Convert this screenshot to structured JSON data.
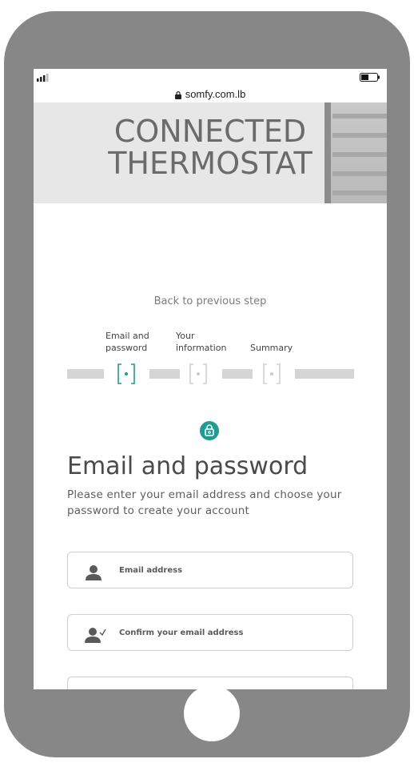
{
  "browser": {
    "url": "somfy.com.lb"
  },
  "hero": {
    "title": "CONNECTED\nTHERMOSTAT"
  },
  "nav": {
    "back_label": "Back to previous step"
  },
  "steps": [
    {
      "label": "Email and\npassword",
      "state": "active"
    },
    {
      "label": "Your\ninformation",
      "state": "inactive"
    },
    {
      "label": "Summary",
      "state": "inactive"
    }
  ],
  "section": {
    "title": "Email and password",
    "description": "Please enter your email address and choose your password to create your account"
  },
  "form": {
    "email_placeholder": "Email address",
    "confirm_email_placeholder": "Confirm your email address",
    "password_placeholder": ""
  },
  "colors": {
    "accent": "#1f9c92",
    "phone_frame": "#878787"
  },
  "icons": {
    "signal": "signal-icon",
    "battery": "battery-icon",
    "lock": "lock-icon",
    "user": "user-icon",
    "user_check": "user-check-icon"
  }
}
